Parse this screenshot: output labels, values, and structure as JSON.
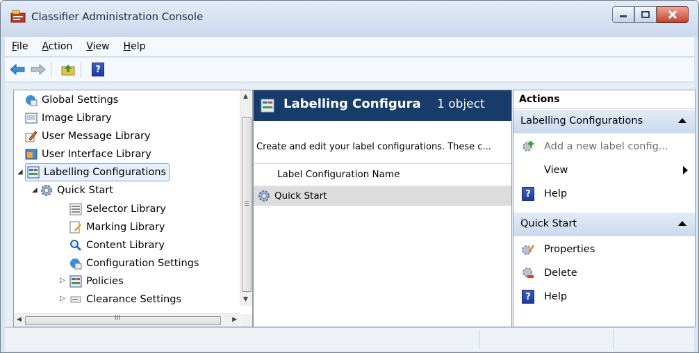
{
  "window": {
    "title": "Classifier Administration Console"
  },
  "menu": [
    {
      "key": "F",
      "rest": "ile"
    },
    {
      "key": "A",
      "rest": "ction"
    },
    {
      "key": "V",
      "rest": "iew"
    },
    {
      "key": "H",
      "rest": "elp"
    }
  ],
  "toolbar": {
    "back": "back-icon",
    "forward": "forward-icon",
    "up": "up-folder-icon",
    "help": "?"
  },
  "tree": {
    "items": [
      {
        "label": "Global Settings",
        "icon": "globe-settings-icon"
      },
      {
        "label": "Image Library",
        "icon": "image-icon"
      },
      {
        "label": "User Message Library",
        "icon": "pencil-note-icon"
      },
      {
        "label": "User Interface Library",
        "icon": "window-icon"
      },
      {
        "label": "Labelling Configurations",
        "icon": "labels-icon"
      },
      {
        "label": "Quick Start",
        "icon": "gear-icon"
      },
      {
        "label": "Selector Library",
        "icon": "list-icon"
      },
      {
        "label": "Marking Library",
        "icon": "marking-icon"
      },
      {
        "label": "Content Library",
        "icon": "magnifier-icon"
      },
      {
        "label": "Configuration Settings",
        "icon": "globe-settings-icon"
      },
      {
        "label": "Policies",
        "icon": "labels-icon"
      },
      {
        "label": "Clearance Settings",
        "icon": "card-icon"
      }
    ],
    "hscroll_mid": "III"
  },
  "middle": {
    "title": "Labelling Configura",
    "count": "1 object",
    "description": "Create and edit your label configurations. These c...",
    "column": "Label Configuration Name",
    "rows": [
      "Quick Start"
    ]
  },
  "actions": {
    "header": "Actions",
    "section1": "Labelling Configurations",
    "s1_items": [
      "Add a new label config...",
      "View",
      "Help"
    ],
    "section2": "Quick Start",
    "s2_items": [
      "Properties",
      "Delete",
      "Help"
    ]
  },
  "colors": {
    "header_bg": "#183c6a",
    "section_bg": "#d0deef",
    "selection": "#dcdcdc"
  }
}
